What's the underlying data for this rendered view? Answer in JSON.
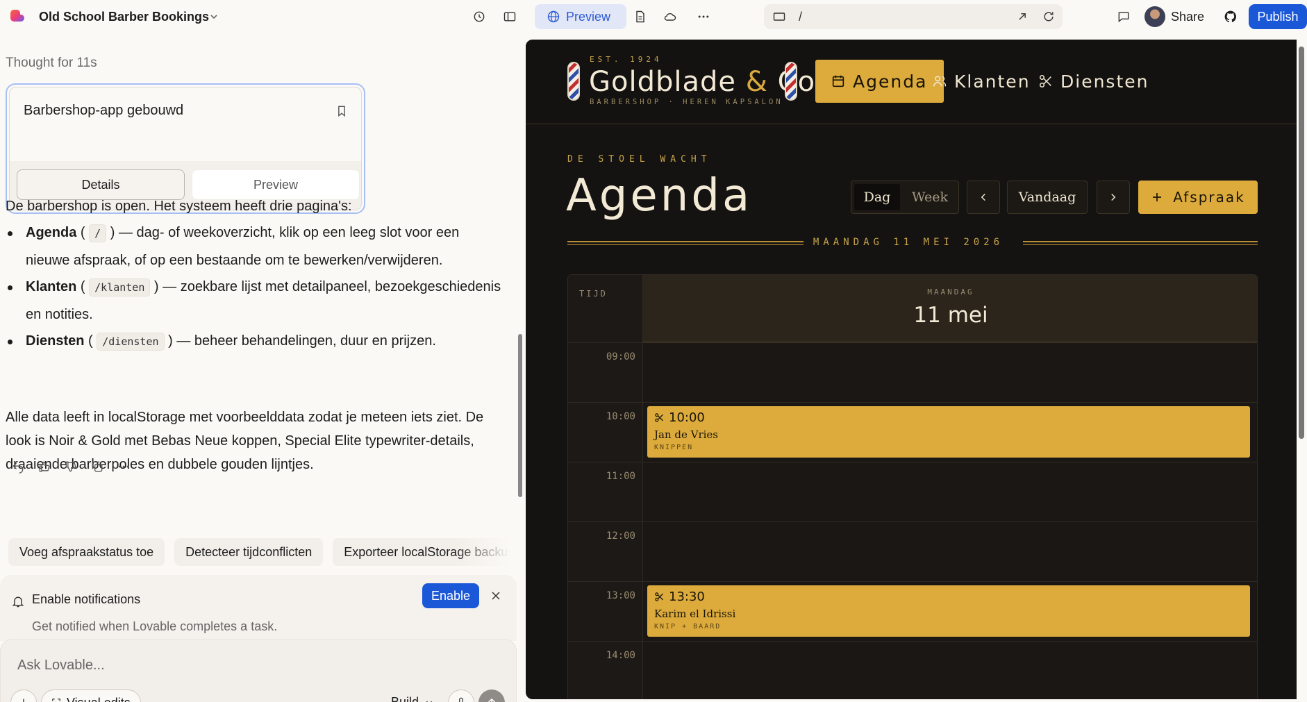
{
  "topbar": {
    "project_title": "Old School Barber Bookings",
    "preview_label": "Preview",
    "url_path": "/",
    "share_label": "Share",
    "publish_label": "Publish"
  },
  "chat": {
    "thought": "Thought for 11s",
    "card": {
      "title": "Barbershop-app gebouwd",
      "tab_details": "Details",
      "tab_preview": "Preview"
    },
    "intro": "De barbershop is open. Het systeem heeft drie pagina's:",
    "bullets": [
      {
        "name": "Agenda",
        "path": "/",
        "desc": "— dag- of weekoverzicht, klik op een leeg slot voor een nieuwe afspraak, of op een bestaande om te bewerken/verwijderen."
      },
      {
        "name": "Klanten",
        "path": "/klanten",
        "desc": "— zoekbare lijst met detailpaneel, bezoekgeschiedenis en notities."
      },
      {
        "name": "Diensten",
        "path": "/diensten",
        "desc": "— beheer behandelingen, duur en prijzen."
      }
    ],
    "outro": "Alle data leeft in localStorage met voorbeelddata zodat je meteen iets ziet. De look is Noir & Gold met Bebas Neue koppen, Special Elite typewriter-details, draaiende barberpoles en dubbele gouden lijntjes.",
    "suggestions": [
      "Voeg afspraakstatus toe",
      "Detecteer tijdconflicten",
      "Exporteer localStorage backup"
    ],
    "notification": {
      "title": "Enable notifications",
      "subtitle": "Get notified when Lovable completes a task.",
      "enable_label": "Enable"
    },
    "composer": {
      "placeholder": "Ask Lovable...",
      "visual_edits_label": "Visual edits",
      "mode_label": "Build"
    }
  },
  "app": {
    "brand": {
      "est": "EST. 1924",
      "name_part1": "Goldblade",
      "amp": "&",
      "name_part2": "Co.",
      "sub": "BARBERSHOP · HEREN KAPSALON"
    },
    "nav": [
      {
        "label": "Agenda",
        "icon": "calendar-icon",
        "active": true
      },
      {
        "label": "Klanten",
        "icon": "users-icon",
        "active": false
      },
      {
        "label": "Diensten",
        "icon": "scissors-icon",
        "active": false
      }
    ],
    "eyebrow": "DE STOEL WACHT",
    "heading": "Agenda",
    "view_toggle": {
      "day": "Dag",
      "week": "Week"
    },
    "today_label": "Vandaag",
    "add_label": "Afspraak",
    "date_label": "MAANDAG 11 MEI 2026",
    "grid": {
      "time_header": "TIJD",
      "day_of_week": "MAANDAG",
      "day_date": "11 mei",
      "hours": [
        "09:00",
        "10:00",
        "11:00",
        "12:00",
        "13:00",
        "14:00"
      ]
    },
    "appointments": [
      {
        "time": "10:00",
        "client": "Jan de Vries",
        "service": "KNIPPEN"
      },
      {
        "time": "13:30",
        "client": "Karim el Idrissi",
        "service": "KNIP + BAARD"
      }
    ]
  },
  "colors": {
    "accent_blue": "#1b58d8",
    "gold": "#dcab3c",
    "noir": "#151311"
  }
}
